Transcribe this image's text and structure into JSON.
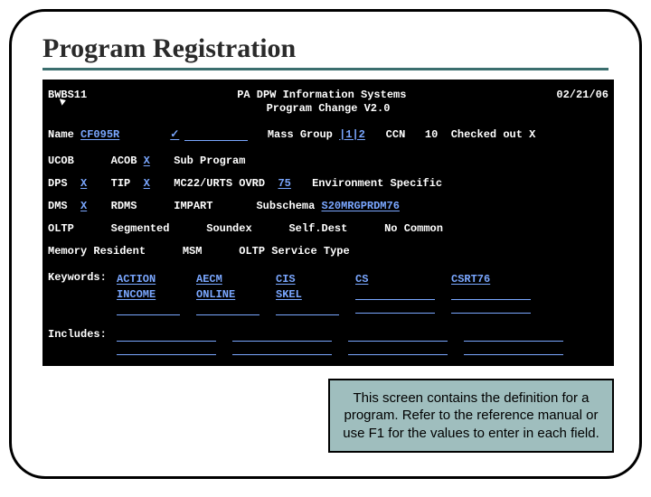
{
  "slide": {
    "title": "Program Registration"
  },
  "terminal": {
    "header": {
      "left": "BWBS11",
      "center_line1": "PA DPW Information Systems",
      "center_line2": "Program Change V2.0",
      "right": "02/21/06"
    },
    "row1": {
      "name_label": "Name",
      "name_value": "CF095R",
      "blank_flag": "✓",
      "mass_group_label": "Mass Group",
      "mass_group_value": "|1|2",
      "ccn_label": "CCN",
      "ccn_value": "10",
      "checked_out_label": "Checked out",
      "checked_out_value": "X"
    },
    "row2": {
      "ucob_label": "UCOB",
      "ucob_value": "",
      "acob_label": "ACOB",
      "acob_value": "X",
      "subprog_label": "Sub Program",
      "subprog_value": ""
    },
    "row3": {
      "dps_label": "DPS",
      "dps_value": "X",
      "tip_label": "TIP",
      "tip_value": "X",
      "mc22_label": "MC22/URTS OVRD",
      "mc22_value": "75",
      "env_label": "Environment Specific",
      "env_value": ""
    },
    "row4": {
      "dms_label": "DMS",
      "dms_value": "X",
      "rdms_label": "RDMS",
      "rdms_value": "",
      "impart_label": "IMPART",
      "impart_value": "",
      "subschema_label": "Subschema",
      "subschema_value": "S20MRGPRDM76"
    },
    "row5": {
      "oltp_label": "OLTP",
      "oltp_value": "",
      "seg_label": "Segmented",
      "seg_value": "",
      "soundex_label": "Soundex",
      "soundex_value": "",
      "selfdest_label": "Self.Dest",
      "selfdest_value": "",
      "nocommon_label": "No Common",
      "nocommon_value": ""
    },
    "row6": {
      "memres_label": "Memory Resident",
      "memres_value": "",
      "msm_label": "MSM",
      "msm_value": "",
      "oltpsvc_label": "OLTP Service Type",
      "oltpsvc_value": ""
    },
    "keywords": {
      "label": "Keywords:",
      "cols": [
        [
          "ACTION",
          "INCOME",
          ""
        ],
        [
          "AECM",
          "ONLINE",
          ""
        ],
        [
          "CIS",
          "SKEL",
          ""
        ],
        [
          "CS",
          "",
          ""
        ],
        [
          "CSRT76",
          "",
          ""
        ]
      ]
    },
    "includes": {
      "label": "Includes:",
      "cols": [
        [
          "",
          ""
        ],
        [
          "",
          ""
        ],
        [
          "",
          ""
        ],
        [
          "",
          ""
        ]
      ]
    }
  },
  "callout": {
    "text": "This screen contains the definition for a program.  Refer to the reference manual or use F1 for the values to enter in each field."
  }
}
